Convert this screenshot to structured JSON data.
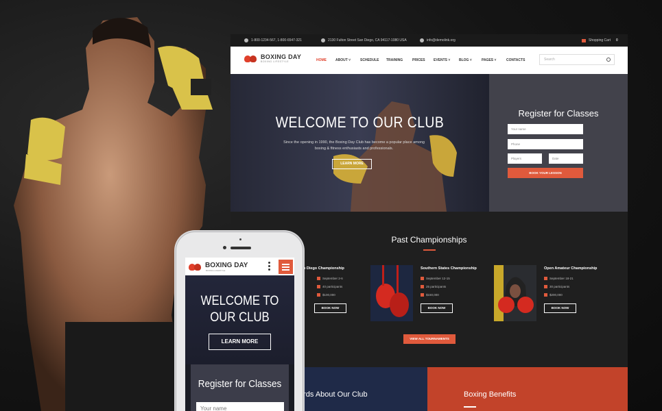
{
  "brand": {
    "name": "BOXING DAY",
    "tagline": "BOXING LIFESTYLE"
  },
  "topbar": {
    "phone": "1-800-1234-567, 1-800-6547-321",
    "address": "2130 Fulton Street San Diego, CA 94117-1080 USA",
    "email": "info@demolink.org",
    "cart_label": "Shopping Cart",
    "cart_count": "0"
  },
  "nav": {
    "items": [
      {
        "label": "HOME"
      },
      {
        "label": "ABOUT ˅"
      },
      {
        "label": "SCHEDULE"
      },
      {
        "label": "TRAINING"
      },
      {
        "label": "PRICES"
      },
      {
        "label": "EVENTS ˅"
      },
      {
        "label": "BLOG ˅"
      },
      {
        "label": "PAGES ˅"
      },
      {
        "label": "CONTACTS"
      }
    ],
    "search_placeholder": "Search"
  },
  "hero": {
    "title": "WELCOME TO OUR CLUB",
    "text": "Since the opening in 1990, the Boxing Day Club has become a popular place among boxing & fitness enthusiasts and professionals.",
    "button": "LEARN MORE"
  },
  "register": {
    "title": "Register for Classes",
    "name_placeholder": "Your name",
    "phone_placeholder": "Phone",
    "players_placeholder": "Players",
    "date_placeholder": "Date",
    "button": "BOOK YOUR LESSON"
  },
  "past": {
    "title": "Past Championships",
    "items": [
      {
        "name": "n Diego Championship",
        "date": "September 2-6",
        "participants": "40 participants",
        "prize": "$100,000",
        "button": "BOOK NOW"
      },
      {
        "name": "Southern States Championship",
        "date": "September 12-15",
        "participants": "25 participants",
        "prize": "$150,000",
        "button": "BOOK NOW"
      },
      {
        "name": "Open Amateur Championship",
        "date": "September 18-21",
        "participants": "30 participants",
        "prize": "$200,000",
        "button": "BOOK NOW"
      }
    ],
    "view_all": "VIEW ALL TOURNAMENTS"
  },
  "sections": {
    "words": "ords About Our Club",
    "benefits": "Boxing Benefits"
  },
  "mobile": {
    "title": "BOXING DAY",
    "tagline": "BOXING LIFESTYLE",
    "hero_title": "WELCOME TO OUR CLUB",
    "button": "LEARN MORE",
    "register_title": "Register for Classes",
    "name_placeholder": "Your name"
  },
  "colors": {
    "accent": "#e05a3c",
    "navy": "#1f2a48",
    "benefits": "#c2432a"
  }
}
